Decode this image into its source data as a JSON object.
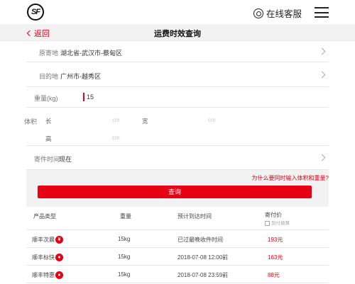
{
  "header": {
    "logo": "SF",
    "customer_service": "在线客服"
  },
  "navbar": {
    "back_label": "返回",
    "title": "运费时效查询"
  },
  "form": {
    "origin": {
      "label": "原寄地",
      "value": "湖北省-武汉市-蔡甸区"
    },
    "destination": {
      "label": "目的地",
      "value": "广州市-越秀区"
    },
    "weight": {
      "label": "重量(kg)",
      "value": "15"
    },
    "volume": {
      "label": "体积",
      "length_label": "长",
      "width_label": "宽",
      "height_label": "高",
      "unit": "cm"
    },
    "send_time": {
      "label": "寄件时间",
      "value": "现在"
    }
  },
  "why_link": "为什么要同时输入体积和重量?",
  "query_button": "查询",
  "table": {
    "headers": {
      "product": "产品类型",
      "weight": "重量",
      "eta": "预计到达时间",
      "price": "寄付价",
      "price_sub": "到付换算"
    },
    "rows": [
      {
        "product": "顺丰次晨",
        "badge": "¥",
        "weight": "15kg",
        "eta": "已过最晚收件时间",
        "price": "193元"
      },
      {
        "product": "顺丰标快",
        "badge": "●",
        "weight": "15kg",
        "eta": "2018-07-08 12:00前",
        "price": "163元"
      },
      {
        "product": "顺丰特惠",
        "badge": "●",
        "weight": "15kg",
        "eta": "2018-07-08 23:59前",
        "price": "88元"
      }
    ]
  },
  "colors": {
    "accent": "#e60012",
    "background_gray": "#f2f2f2"
  }
}
